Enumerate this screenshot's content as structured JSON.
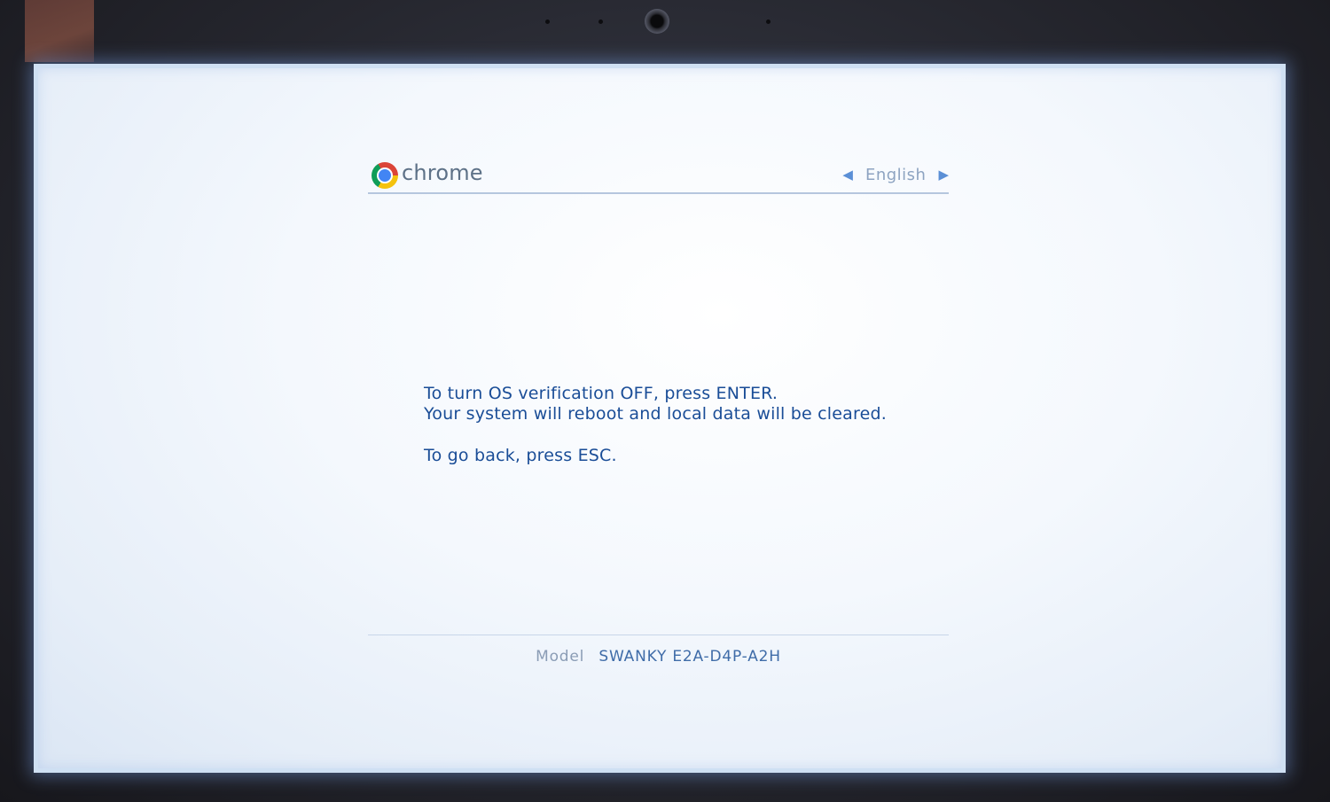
{
  "header": {
    "brand": "chrome",
    "language": "English",
    "prev_icon": "left-triangle-icon",
    "next_icon": "right-triangle-icon"
  },
  "message": {
    "line1": "To turn OS verification OFF, press ENTER.",
    "line2": "Your system will reboot and local data will be cleared.",
    "line3": "To go back, press ESC."
  },
  "footer": {
    "model_label": "Model",
    "model_value": "SWANKY E2A-D4P-A2H"
  },
  "colors": {
    "message_text": "#1a4d97",
    "screen_bg": "#f4f8fd",
    "arrow": "#5b8fd6"
  }
}
